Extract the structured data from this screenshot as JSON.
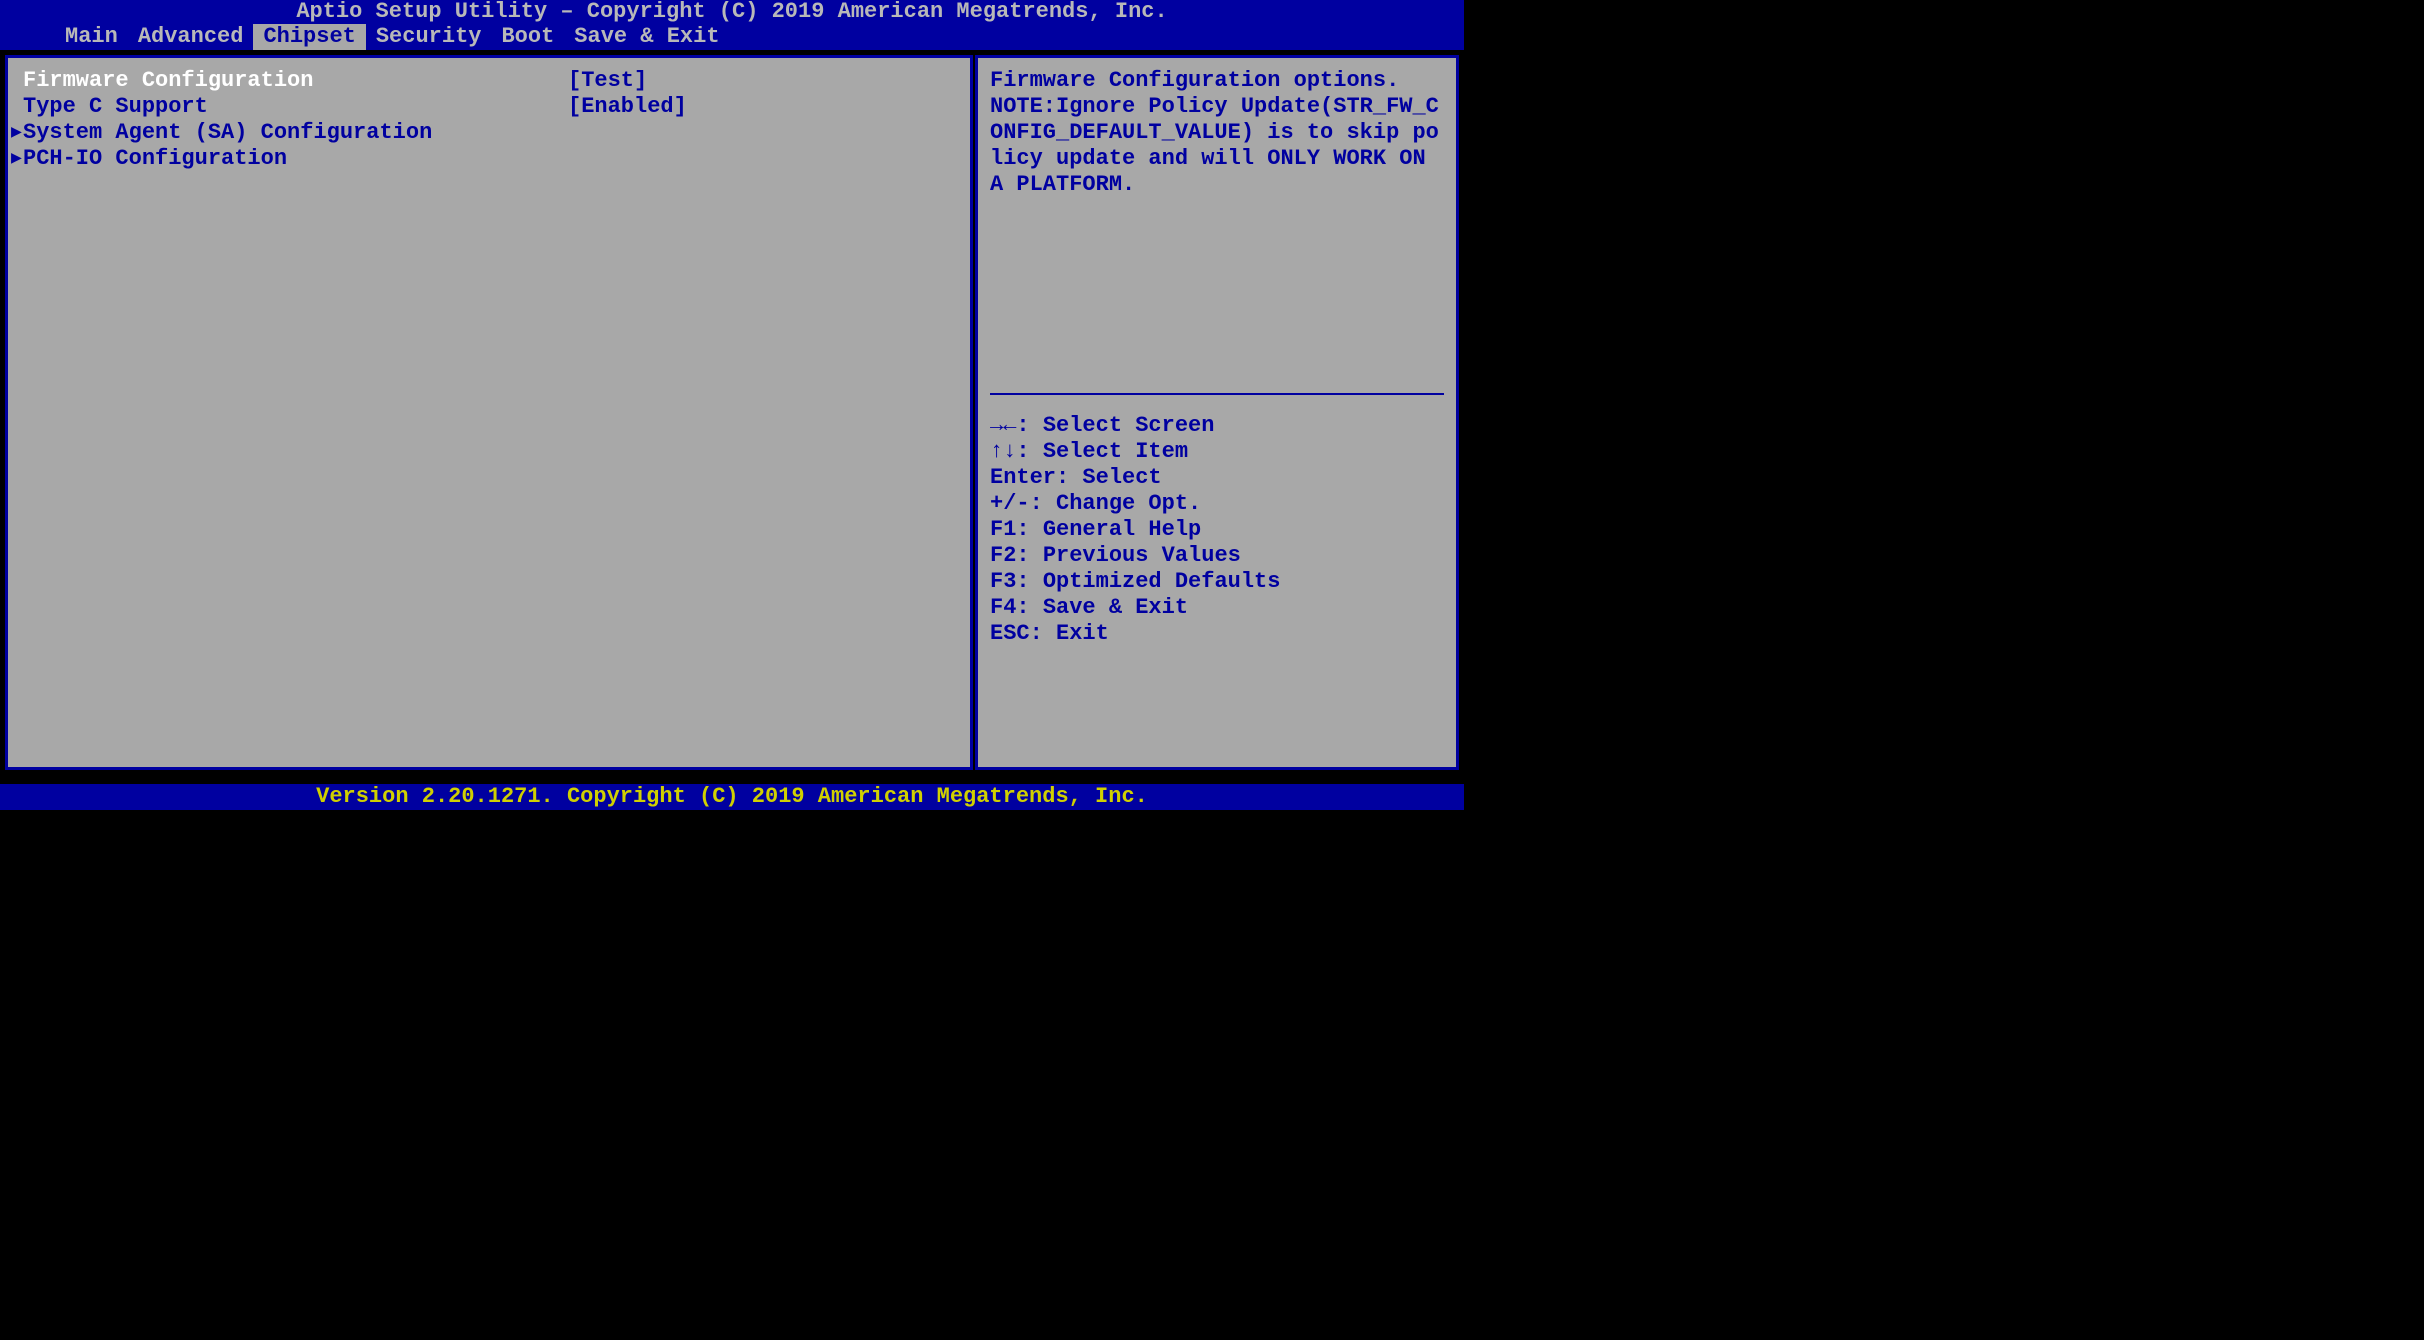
{
  "header": {
    "title": "Aptio Setup Utility – Copyright (C) 2019 American Megatrends, Inc."
  },
  "tabs": [
    {
      "label": "Main"
    },
    {
      "label": "Advanced"
    },
    {
      "label": "Chipset",
      "active": true
    },
    {
      "label": "Security"
    },
    {
      "label": "Boot"
    },
    {
      "label": "Save & Exit"
    }
  ],
  "options": [
    {
      "label": "Firmware Configuration",
      "value": "[Test]",
      "selected": true,
      "type": "setting"
    },
    {
      "label": "Type C Support",
      "value": "[Enabled]",
      "selected": false,
      "type": "setting"
    },
    {
      "label": "System Agent (SA) Configuration",
      "value": "",
      "selected": false,
      "type": "submenu"
    },
    {
      "label": "PCH-IO Configuration",
      "value": "",
      "selected": false,
      "type": "submenu"
    }
  ],
  "help": {
    "text": "Firmware Configuration options.\nNOTE:Ignore Policy Update(STR_FW_CONFIG_DEFAULT_VALUE) is to skip policy update and will ONLY WORK ON A PLATFORM."
  },
  "keys": [
    {
      "symbol": "→←: ",
      "label": "Select Screen"
    },
    {
      "symbol": "↑↓: ",
      "label": "Select Item"
    },
    {
      "symbol": "Enter: ",
      "label": "Select"
    },
    {
      "symbol": "+/-: ",
      "label": "Change Opt."
    },
    {
      "symbol": "F1: ",
      "label": "General Help"
    },
    {
      "symbol": "F2: ",
      "label": "Previous Values"
    },
    {
      "symbol": "F3: ",
      "label": "Optimized Defaults"
    },
    {
      "symbol": "F4: ",
      "label": "Save & Exit"
    },
    {
      "symbol": "ESC: ",
      "label": "Exit"
    }
  ],
  "footer": {
    "text": "Version 2.20.1271. Copyright (C) 2019 American Megatrends, Inc."
  }
}
